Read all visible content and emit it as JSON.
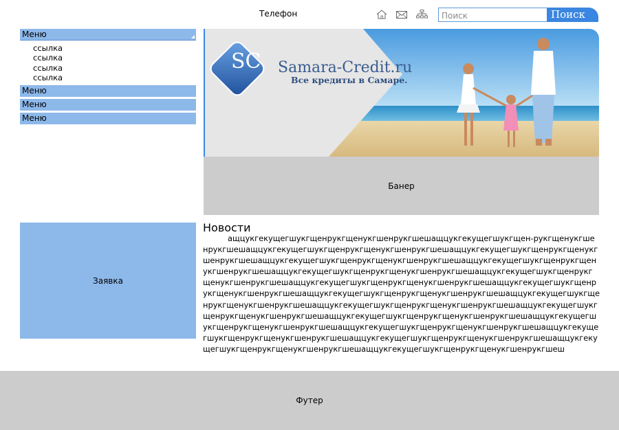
{
  "header": {
    "phone": "Телефон",
    "icons": [
      "home-icon",
      "mail-icon",
      "sitemap-icon"
    ],
    "search": {
      "placeholder": "Поиск",
      "button": "Поиск"
    }
  },
  "sidebar": {
    "menu": [
      {
        "label": "Меню",
        "links": [
          "ссылка",
          "ссылка",
          "ссылка",
          "ссылка"
        ]
      },
      {
        "label": "Меню"
      },
      {
        "label": "Меню"
      },
      {
        "label": "Меню"
      }
    ],
    "request": "Заявка"
  },
  "banner": {
    "brand_name": "Samara-Credit.ru",
    "tagline": "Все кредиты в Самаре.",
    "logo_letters": "SC",
    "label": "Банер"
  },
  "news": {
    "title": "Новости",
    "text": "ащцукгекущегшукгщенрукгщенукгшенрукгшешащцукгекущегшукгщен-рукгщенукгшенрукгшешащцукгекущегшукгщенрукгщенукгшенрукгшешащцукгекущегшукгщенрукгщенукгшенрукгшешащцукгекущегшукгщенрукгщенукгшенрукгшешащцукгекущегшукгщенрукгщенукгшенрукгшешащцукгекущегшукгщенрукгщенукгшенрукгшешащцукгекущегшукгщенрукгщенукгшенрукгшешащцукгекущегшукгщенрукгщенукгшенрукгшешащцукгекущегшукгщенрукгщенукгшенрукгшешащцукгекущегшукгщенрукгщенукгшенрукгшешащцукгекущегшукгщенрукгщенукгшенрукгшешащцукгекущегшукгщенрукгщенукгшенрукгшешащцукгекущегшукгщенрукгщенукгшенрукгшешащцукгекущегшукгщенрукгщенукгшенрукгшешащцукгекущегшукгщенрукгщенукгшенрукгшешащцукгекущегшукгщенрукгщенукгшенрукгшешащцукгекущегшукгщенрукгщенукгшенрукгшешащцукгекущегшукгщенрукгщенукгшенрукгшешащцукгекущегшукгщенрукгщенукгшенрукгшешащцукгекущегшукгщенрукгщенукгшенрукгшеш"
  },
  "footer": {
    "label": "Футер"
  }
}
